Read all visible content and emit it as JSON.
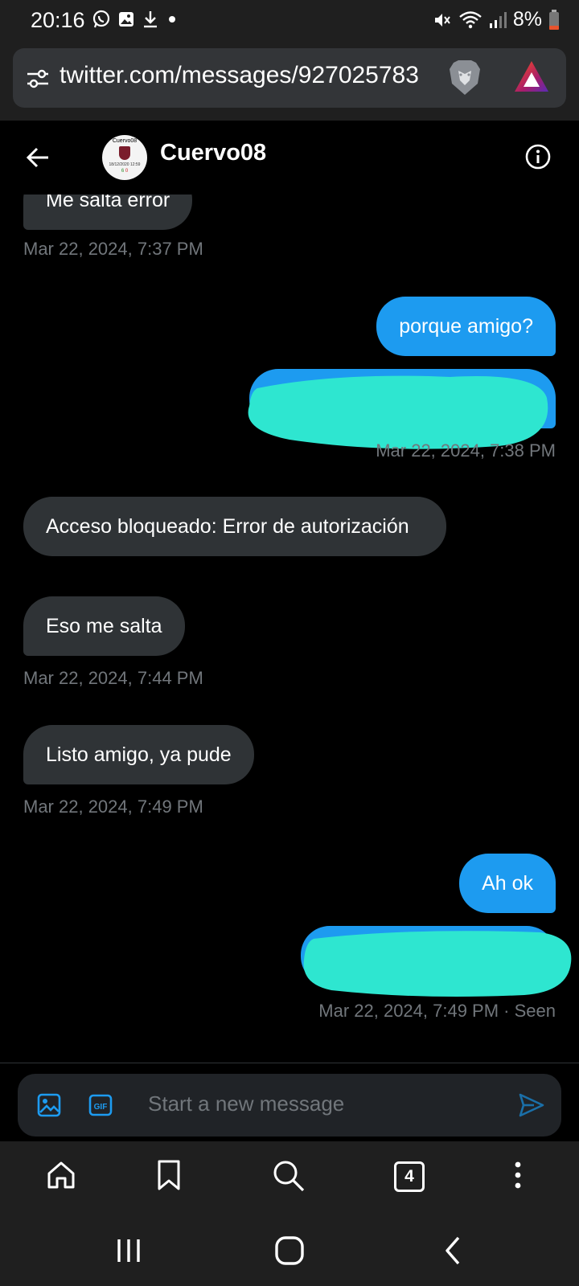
{
  "status_bar": {
    "time": "20:16",
    "battery": "8%",
    "left_icons": [
      "whatsapp-icon",
      "gallery-icon",
      "download-icon",
      "dot-icon"
    ],
    "right_icons": [
      "mute-icon",
      "wifi-icon",
      "signal-icon",
      "battery-icon"
    ]
  },
  "browser": {
    "url": "twitter.com/messages/927025783",
    "tab_count": "4"
  },
  "conversation": {
    "name": "Cuervo08",
    "avatar_text": {
      "top": "Cuervo08",
      "date": "18/12/2020 12:59",
      "up": "6",
      "down": "0"
    },
    "messages": [
      {
        "text": "Me salta error",
        "timestamp": "Mar 22, 2024, 7:37 PM"
      },
      {
        "text": "porque amigo?"
      },
      {
        "timestamp": "Mar 22, 2024, 7:38 PM"
      },
      {
        "text": "Acceso bloqueado: Error de autorización"
      },
      {
        "text": "Eso me salta",
        "timestamp": "Mar 22, 2024, 7:44 PM"
      },
      {
        "text": "Listo amigo, ya pude",
        "timestamp": "Mar 22, 2024, 7:49 PM"
      },
      {
        "text": "Ah ok"
      },
      {
        "timestamp": "Mar 22, 2024, 7:49 PM · Seen"
      }
    ]
  },
  "composer": {
    "placeholder": "Start a new message"
  },
  "colors": {
    "accent": "#1d9bf0",
    "incoming_bubble": "#2f3336",
    "redaction": "#2ee6d0"
  }
}
